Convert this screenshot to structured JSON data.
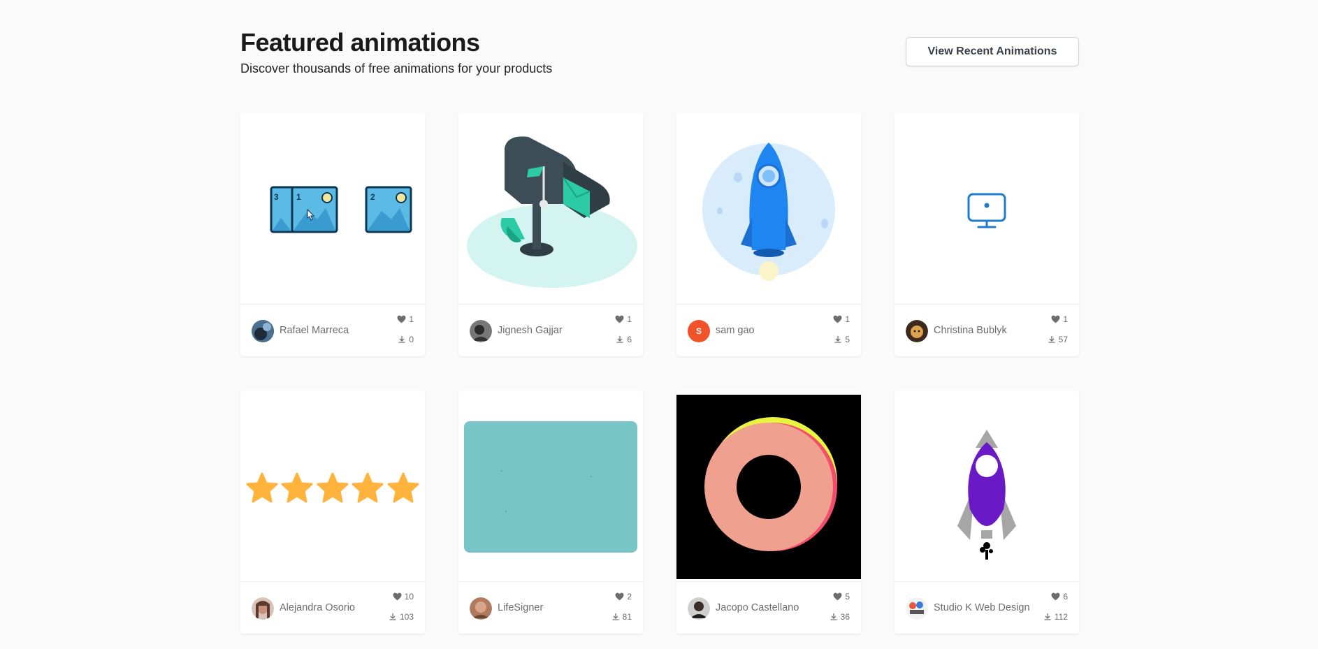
{
  "header": {
    "title": "Featured animations",
    "subtitle": "Discover thousands of free animations for your products",
    "view_recent_label": "View Recent Animations"
  },
  "cards": [
    {
      "author": "Rafael Marreca",
      "likes": "1",
      "downloads": "0",
      "avatar": "photo"
    },
    {
      "author": "Jignesh Gajjar",
      "likes": "1",
      "downloads": "6",
      "avatar": "photo"
    },
    {
      "author": "sam gao",
      "likes": "1",
      "downloads": "5",
      "avatar": "initial",
      "initial": "S",
      "avatar_color": "#f0522a"
    },
    {
      "author": "Christina Bublyk",
      "likes": "1",
      "downloads": "57",
      "avatar": "photo"
    },
    {
      "author": "Alejandra Osorio",
      "likes": "10",
      "downloads": "103",
      "avatar": "photo"
    },
    {
      "author": "LifeSigner",
      "likes": "2",
      "downloads": "81",
      "avatar": "photo"
    },
    {
      "author": "Jacopo Castellano",
      "likes": "5",
      "downloads": "36",
      "avatar": "photo"
    },
    {
      "author": "Studio K Web Design",
      "likes": "6",
      "downloads": "112",
      "avatar": "photo"
    }
  ],
  "icons": {
    "like": "heart-icon",
    "download": "download-icon"
  },
  "preview_labels": {
    "image_stack_numbers": [
      "3",
      "1",
      "2"
    ]
  }
}
